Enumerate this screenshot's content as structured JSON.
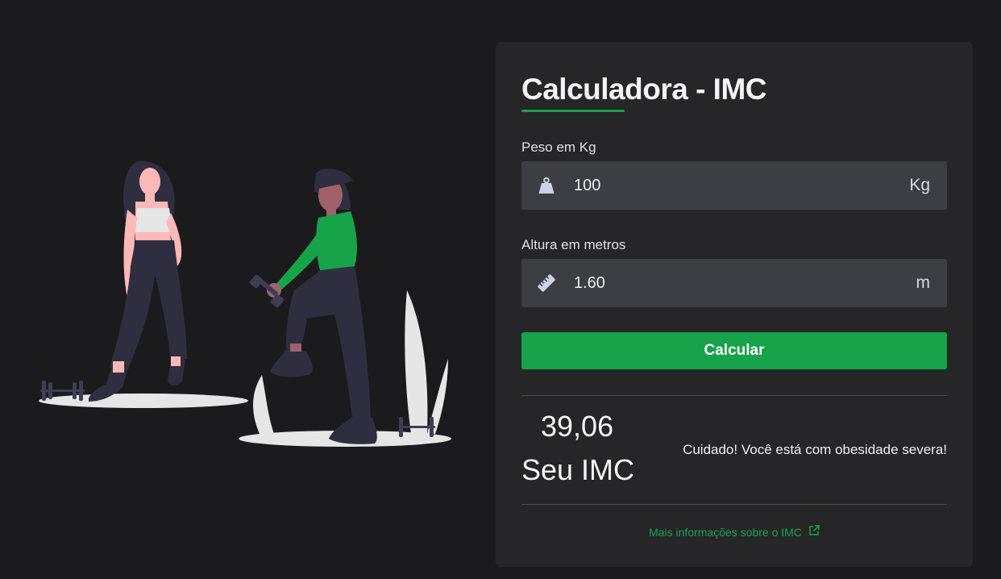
{
  "calculator": {
    "title": "Calculadora - IMC",
    "weight": {
      "label": "Peso em Kg",
      "value": "100",
      "unit": "Kg",
      "icon": "weight-icon"
    },
    "height": {
      "label": "Altura em metros",
      "value": "1.60",
      "unit": "m",
      "icon": "ruler-icon"
    },
    "button_label": "Calcular",
    "result": {
      "value": "39,06",
      "label": "Seu IMC",
      "message": "Cuidado! Você está com obesidade severa!"
    },
    "more_info_link": "Mais informações sobre o IMC"
  },
  "colors": {
    "background": "#1b1b1d",
    "card": "#262628",
    "input": "#3d3e44",
    "accent": "#16a34a"
  }
}
